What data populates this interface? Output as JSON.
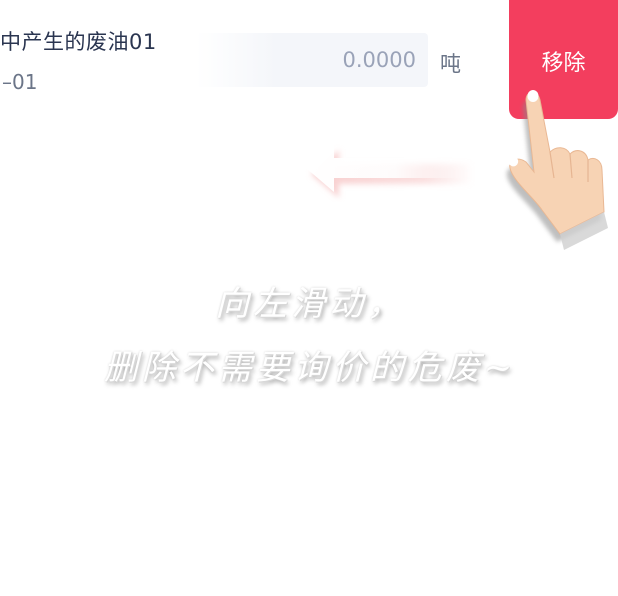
{
  "item": {
    "title": "中产生的废油01",
    "subtitle": "–01",
    "quantity_value": "0.0000",
    "unit": "吨",
    "remove_label": "移除"
  },
  "guide": {
    "line1": "向左滑动，",
    "line2": "删除不需要询价的危废~"
  },
  "icons": {
    "arrow": "swipe-left-arrow-icon",
    "hand": "pointing-hand-icon"
  },
  "colors": {
    "remove_button": "#f33e5e",
    "title_text": "#2a3550",
    "muted_text": "#6b7588",
    "input_text": "#9aa3b8"
  }
}
